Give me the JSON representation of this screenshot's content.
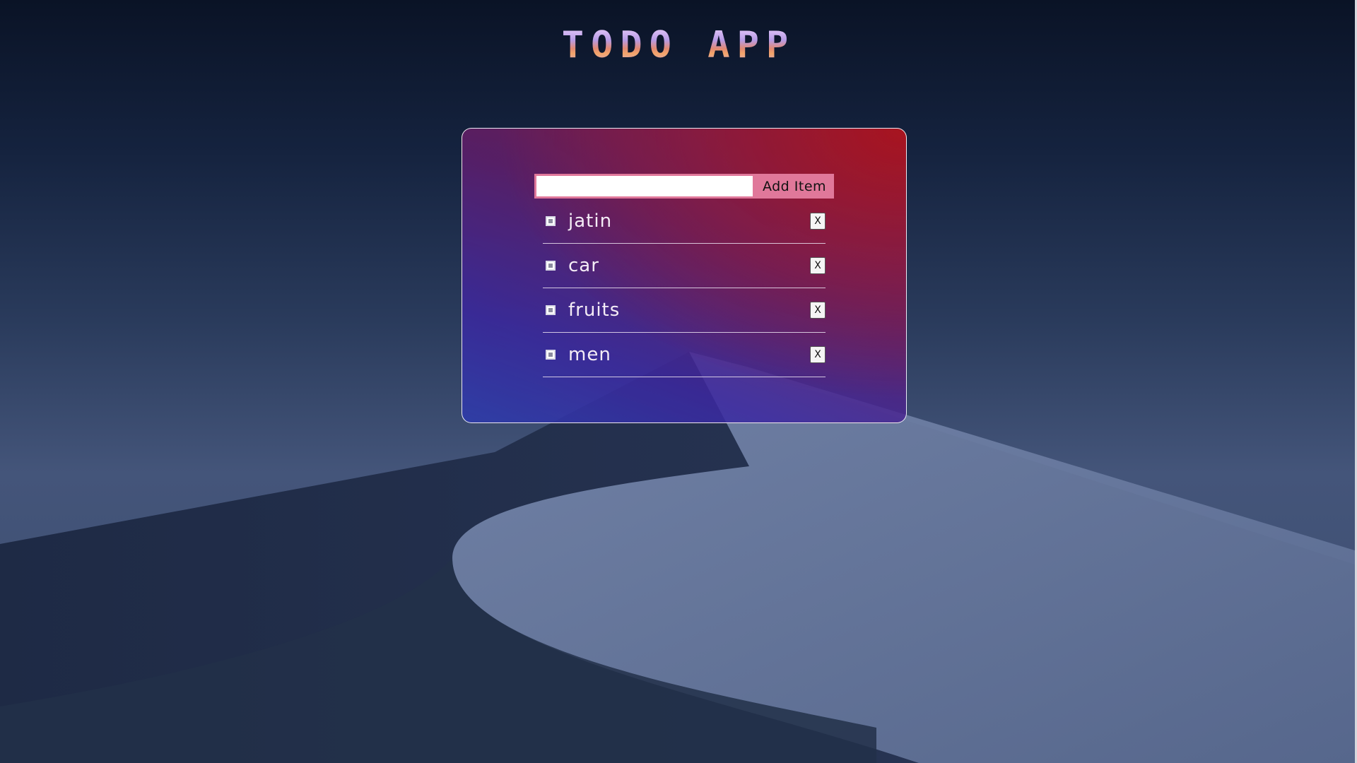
{
  "app": {
    "title": "TODO APP"
  },
  "add_form": {
    "input_value": "",
    "button_label": "Add Item"
  },
  "todos": [
    {
      "label": "jatin",
      "delete_label": "X",
      "checked": false
    },
    {
      "label": "car",
      "delete_label": "X",
      "checked": false
    },
    {
      "label": "fruits",
      "delete_label": "X",
      "checked": false
    },
    {
      "label": "men",
      "delete_label": "X",
      "checked": false
    }
  ],
  "colors": {
    "accent_pink": "#e0789a",
    "card_red": "#aa141e",
    "card_blue": "#2d3caa"
  }
}
